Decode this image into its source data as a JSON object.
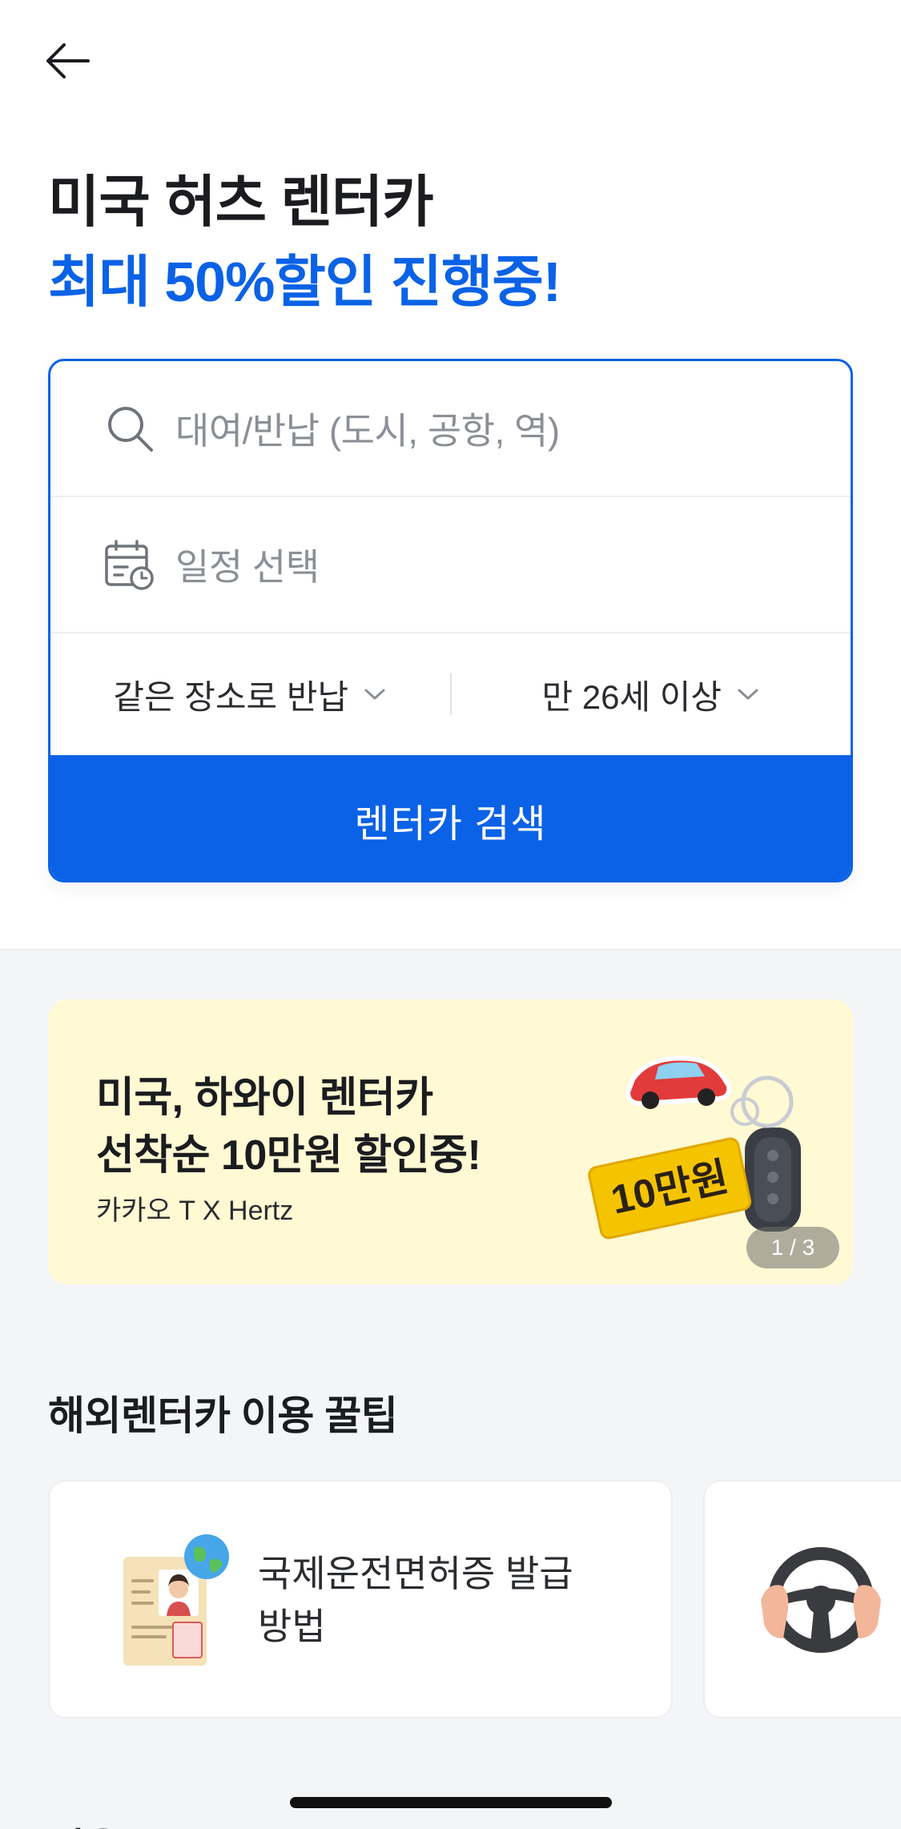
{
  "header": {
    "back_icon": "arrow-left-icon",
    "title_line1": "미국 허츠 렌터카",
    "title_line2": "최대 50%할인 진행중!"
  },
  "colors": {
    "accent": "#0b62e6",
    "banner_bg": "#fff9d4",
    "page_bg": "#f4f5f7"
  },
  "search": {
    "location_placeholder": "대여/반납 (도시, 공항, 역)",
    "location_icon": "search-icon",
    "date_placeholder": "일정 선택",
    "date_icon": "calendar-clock-icon",
    "return_option": "같은 장소로 반납",
    "age_option": "만 26세 이상",
    "button_label": "렌터카 검색"
  },
  "banner": {
    "line1": "미국, 하와이 렌터카",
    "line2": "선착순 10만원 할인중!",
    "subtitle": "카카오 T X Hertz",
    "tag_text": "10만원",
    "pager": "1 / 3"
  },
  "tips": {
    "section_title": "해외렌터카 이용 꿀팁",
    "items": [
      {
        "label": "국제운전면허증 발급 방법",
        "icon": "license-globe-icon"
      },
      {
        "label": "",
        "icon": "steering-wheel-icon"
      }
    ]
  },
  "next_section_title": "이용 중 Q&A"
}
